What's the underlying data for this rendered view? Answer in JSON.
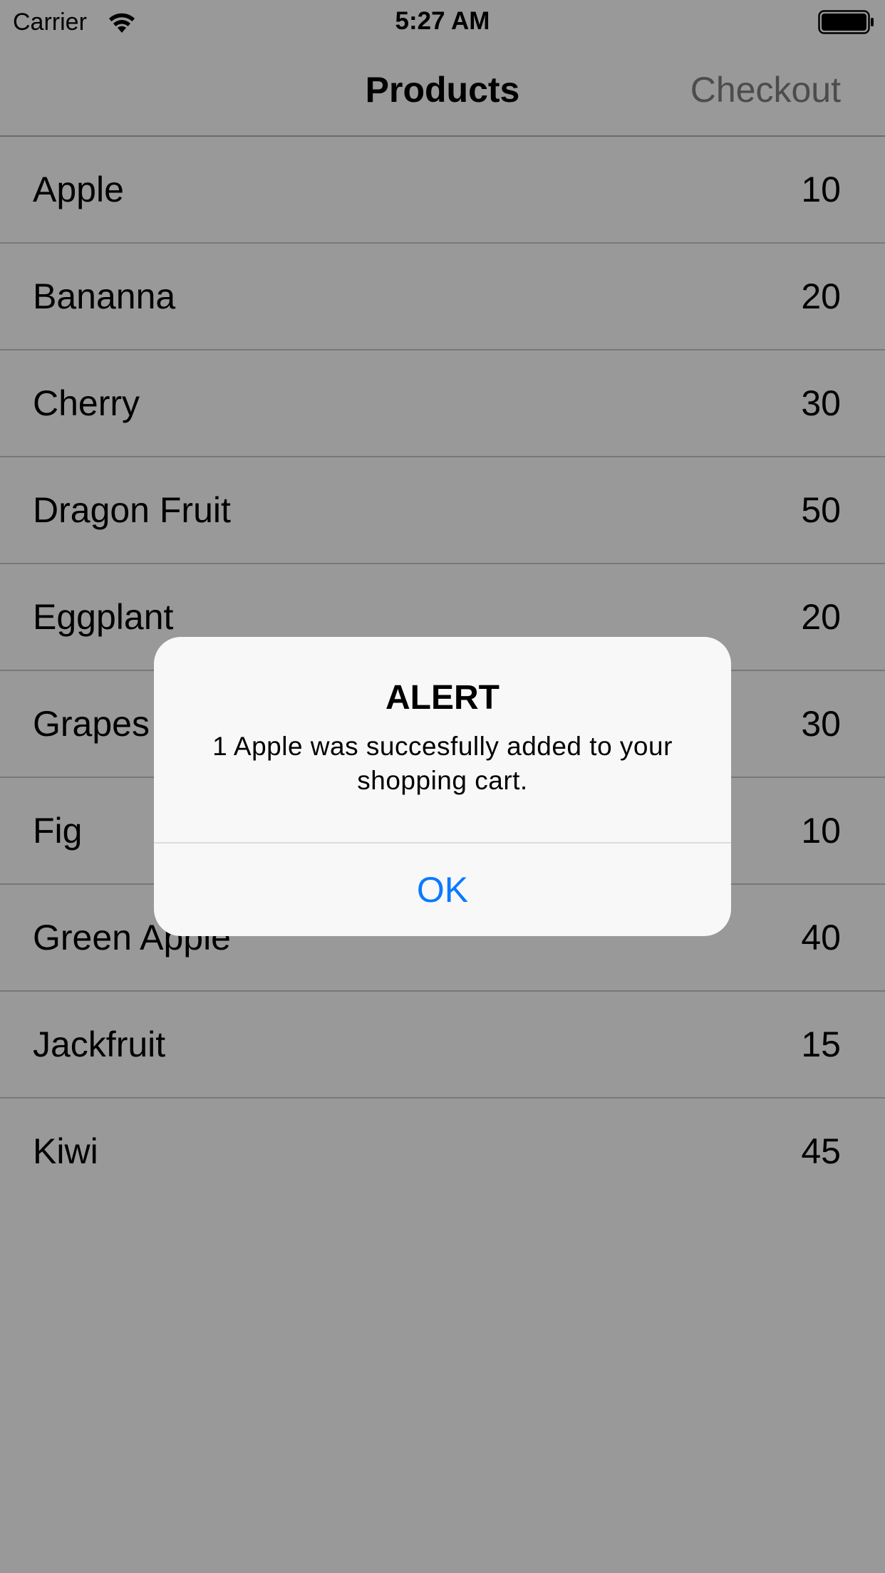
{
  "status_bar": {
    "carrier": "Carrier",
    "time": "5:27 AM"
  },
  "nav": {
    "title": "Products",
    "checkout_label": "Checkout"
  },
  "products": [
    {
      "name": "Apple",
      "price": "10"
    },
    {
      "name": "Bananna",
      "price": "20"
    },
    {
      "name": "Cherry",
      "price": "30"
    },
    {
      "name": "Dragon Fruit",
      "price": "50"
    },
    {
      "name": "Eggplant",
      "price": "20"
    },
    {
      "name": "Grapes",
      "price": "30"
    },
    {
      "name": "Fig",
      "price": "10"
    },
    {
      "name": "Green Apple",
      "price": "40"
    },
    {
      "name": "Jackfruit",
      "price": "15"
    },
    {
      "name": "Kiwi",
      "price": "45"
    }
  ],
  "alert": {
    "title": "ALERT",
    "message": "1 Apple was succesfully added to your shopping cart.",
    "ok_label": "OK"
  },
  "colors": {
    "accent": "#0a7aff",
    "checkout_disabled": "#7f7f7f",
    "overlay": "rgba(0,0,0,0.4)"
  }
}
